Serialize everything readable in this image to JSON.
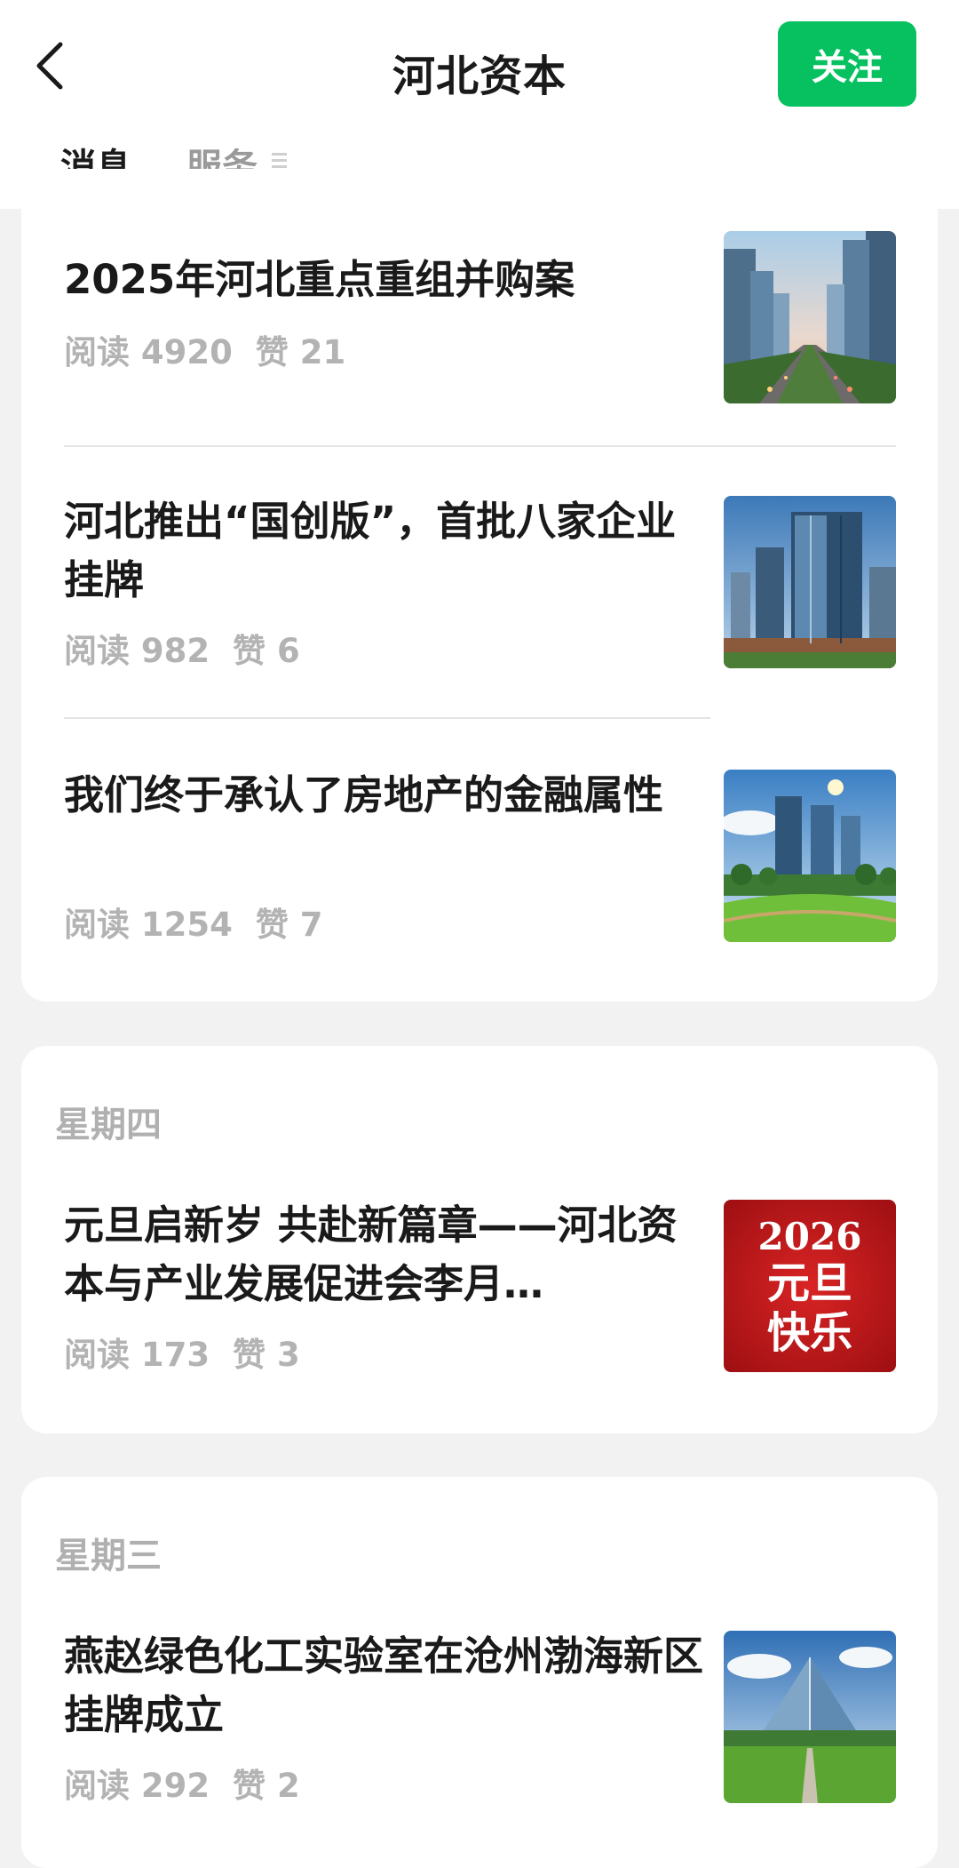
{
  "header": {
    "title": "河北资本",
    "follow_label": "关注"
  },
  "tabs": [
    {
      "label": "消息",
      "active": true
    },
    {
      "label": "服务",
      "active": false
    }
  ],
  "groups": [
    {
      "day_label": "",
      "articles": [
        {
          "title": "2025年河北重点重组并购案",
          "reads": "阅读 4920",
          "likes": "赞 21",
          "thumb": "city-skyline-avenue"
        },
        {
          "title": "河北推出“国创版”，首批八家企业挂牌",
          "reads": "阅读 982",
          "likes": "赞 6",
          "thumb": "glass-office-tower"
        },
        {
          "title": "我们终于承认了房地产的金融属性",
          "reads": "阅读 1254",
          "likes": "赞 7",
          "thumb": "towers-green-lawn"
        }
      ]
    },
    {
      "day_label": "星期四",
      "articles": [
        {
          "title": "元旦启新岁 共赴新篇章——河北资本与产业发展促进会李月…",
          "reads": "阅读 173",
          "likes": "赞 3",
          "thumb": "new-year-banner",
          "thumb_text": [
            "2026",
            "元旦",
            "快乐"
          ]
        }
      ]
    },
    {
      "day_label": "星期三",
      "articles": [
        {
          "title": "燕赵绿色化工实验室在沧州渤海新区挂牌成立",
          "reads": "阅读 292",
          "likes": "赞 2",
          "thumb": "glass-pavilion"
        }
      ]
    }
  ],
  "colors": {
    "accent": "#07c160",
    "background": "#f2f2f2",
    "meta_text": "#b3b3b3",
    "new_year_red": "#c8161d"
  }
}
